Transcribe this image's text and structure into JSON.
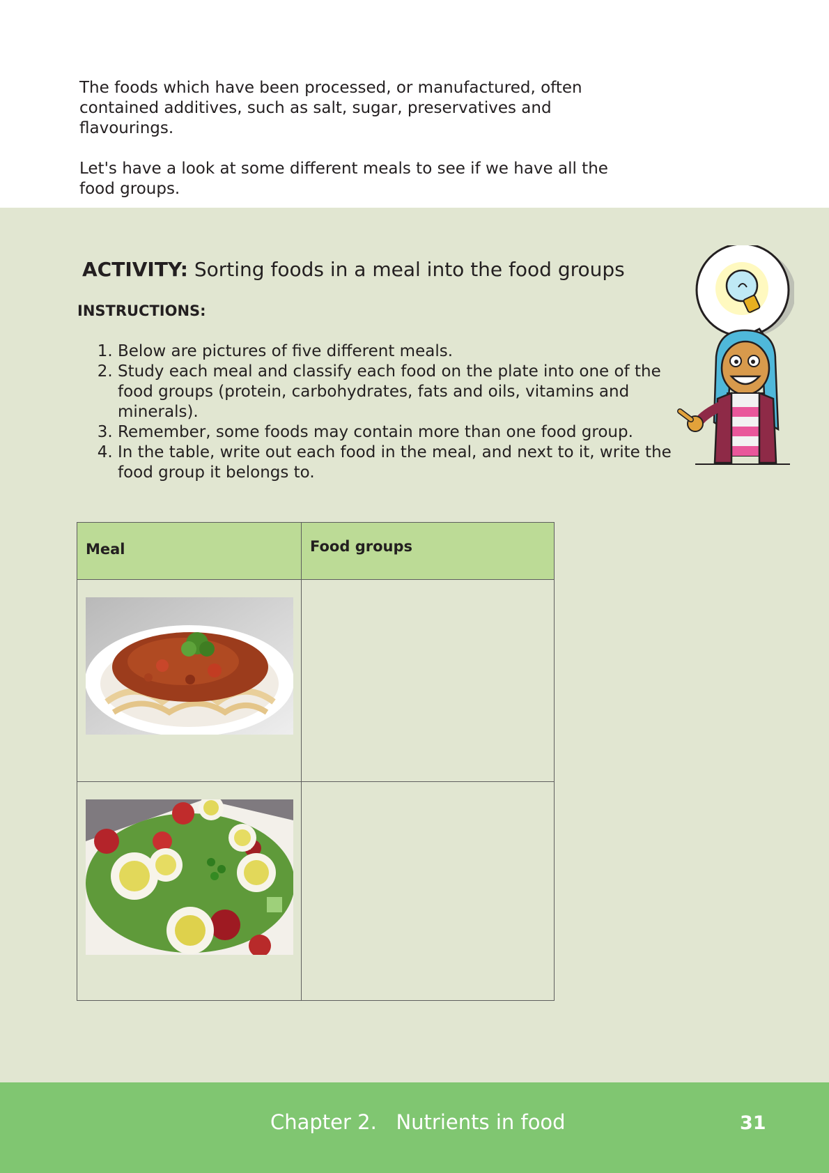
{
  "intro": {
    "paragraph_1": "The foods which have been processed, or manufactured, often contained additives, such as salt, sugar, preservatives and flavourings.",
    "paragraph_2": "Let's have a look at some different meals to see if we have all the food groups."
  },
  "activity": {
    "label": "ACTIVITY:",
    "title": " Sorting foods in a meal into the food groups",
    "instructions_heading": "INSTRUCTIONS:",
    "instructions": [
      "Below are pictures of five different meals.",
      "Study each meal and classify each food on the plate into one of the food groups (protein, carbohydrates, fats and oils, vitamins and minerals).",
      "Remember, some foods may contain more than one food group.",
      "In the table, write out each food in the meal, and next to it, write the food group it belongs to."
    ]
  },
  "table": {
    "headers": {
      "meal": "Meal",
      "food_groups": "Food groups"
    },
    "rows": [
      {
        "meal_image": "spaghetti-bolognese-photo",
        "food_groups": ""
      },
      {
        "meal_image": "egg-salad-photo",
        "food_groups": ""
      }
    ]
  },
  "footer": {
    "chapter": "Chapter 2.   Nutrients in food",
    "page_number": "31",
    "background_color": "#80c671"
  },
  "colors": {
    "activity_panel": "#e1e6d1",
    "table_header": "#bcdb96"
  },
  "icons": {
    "character": "idea-character-lightbulb-icon"
  }
}
